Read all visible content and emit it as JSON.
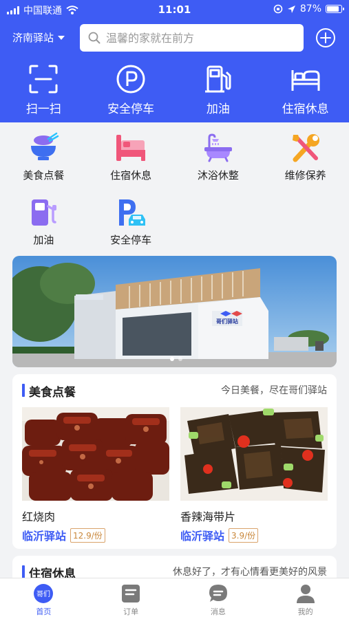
{
  "status_bar": {
    "carrier": "中国联通",
    "time": "11:01",
    "battery": "87%",
    "battery_level": 0.87
  },
  "header": {
    "location": "济南驿站",
    "search_placeholder": "温馨的家就在前方",
    "quick_actions": [
      {
        "label": "扫一扫",
        "icon": "scan-icon"
      },
      {
        "label": "安全停车",
        "icon": "parking-icon"
      },
      {
        "label": "加油",
        "icon": "fuel-pump-icon"
      },
      {
        "label": "住宿休息",
        "icon": "bed-icon"
      }
    ]
  },
  "services": [
    {
      "label": "美食点餐",
      "icon": "food-bowl-icon"
    },
    {
      "label": "住宿休息",
      "icon": "bed-icon"
    },
    {
      "label": "沐浴休整",
      "icon": "bathtub-icon"
    },
    {
      "label": "维修保养",
      "icon": "repair-tools-icon"
    },
    {
      "label": "加油",
      "icon": "fuel-pump-icon"
    },
    {
      "label": "安全停车",
      "icon": "parking-car-icon"
    }
  ],
  "banner": {
    "sign_text": "哥们驿站",
    "slides": 2,
    "active_slide": 1
  },
  "food_section": {
    "title": "美食点餐",
    "subtitle": "今日美餐，尽在哥们驿站",
    "dishes": [
      {
        "name": "红烧肉",
        "station": "临沂驿站",
        "price": "12.9/份"
      },
      {
        "name": "香辣海带片",
        "station": "临沂驿站",
        "price": "3.9/份"
      }
    ]
  },
  "stay_section": {
    "title": "住宿休息",
    "subtitle": "休息好了，才有心情看更美好的风景"
  },
  "tab_bar": [
    {
      "label": "首页",
      "icon": "home-logo-icon",
      "active": true,
      "badge_text": "哥们"
    },
    {
      "label": "订单",
      "icon": "order-icon",
      "active": false
    },
    {
      "label": "消息",
      "icon": "message-icon",
      "active": false
    },
    {
      "label": "我的",
      "icon": "profile-icon",
      "active": false
    }
  ],
  "colors": {
    "brand_blue": "#3e5cf4",
    "price_orange": "#c9873a",
    "icon_purple": "#8b6cf0",
    "icon_pink": "#f0567a"
  }
}
